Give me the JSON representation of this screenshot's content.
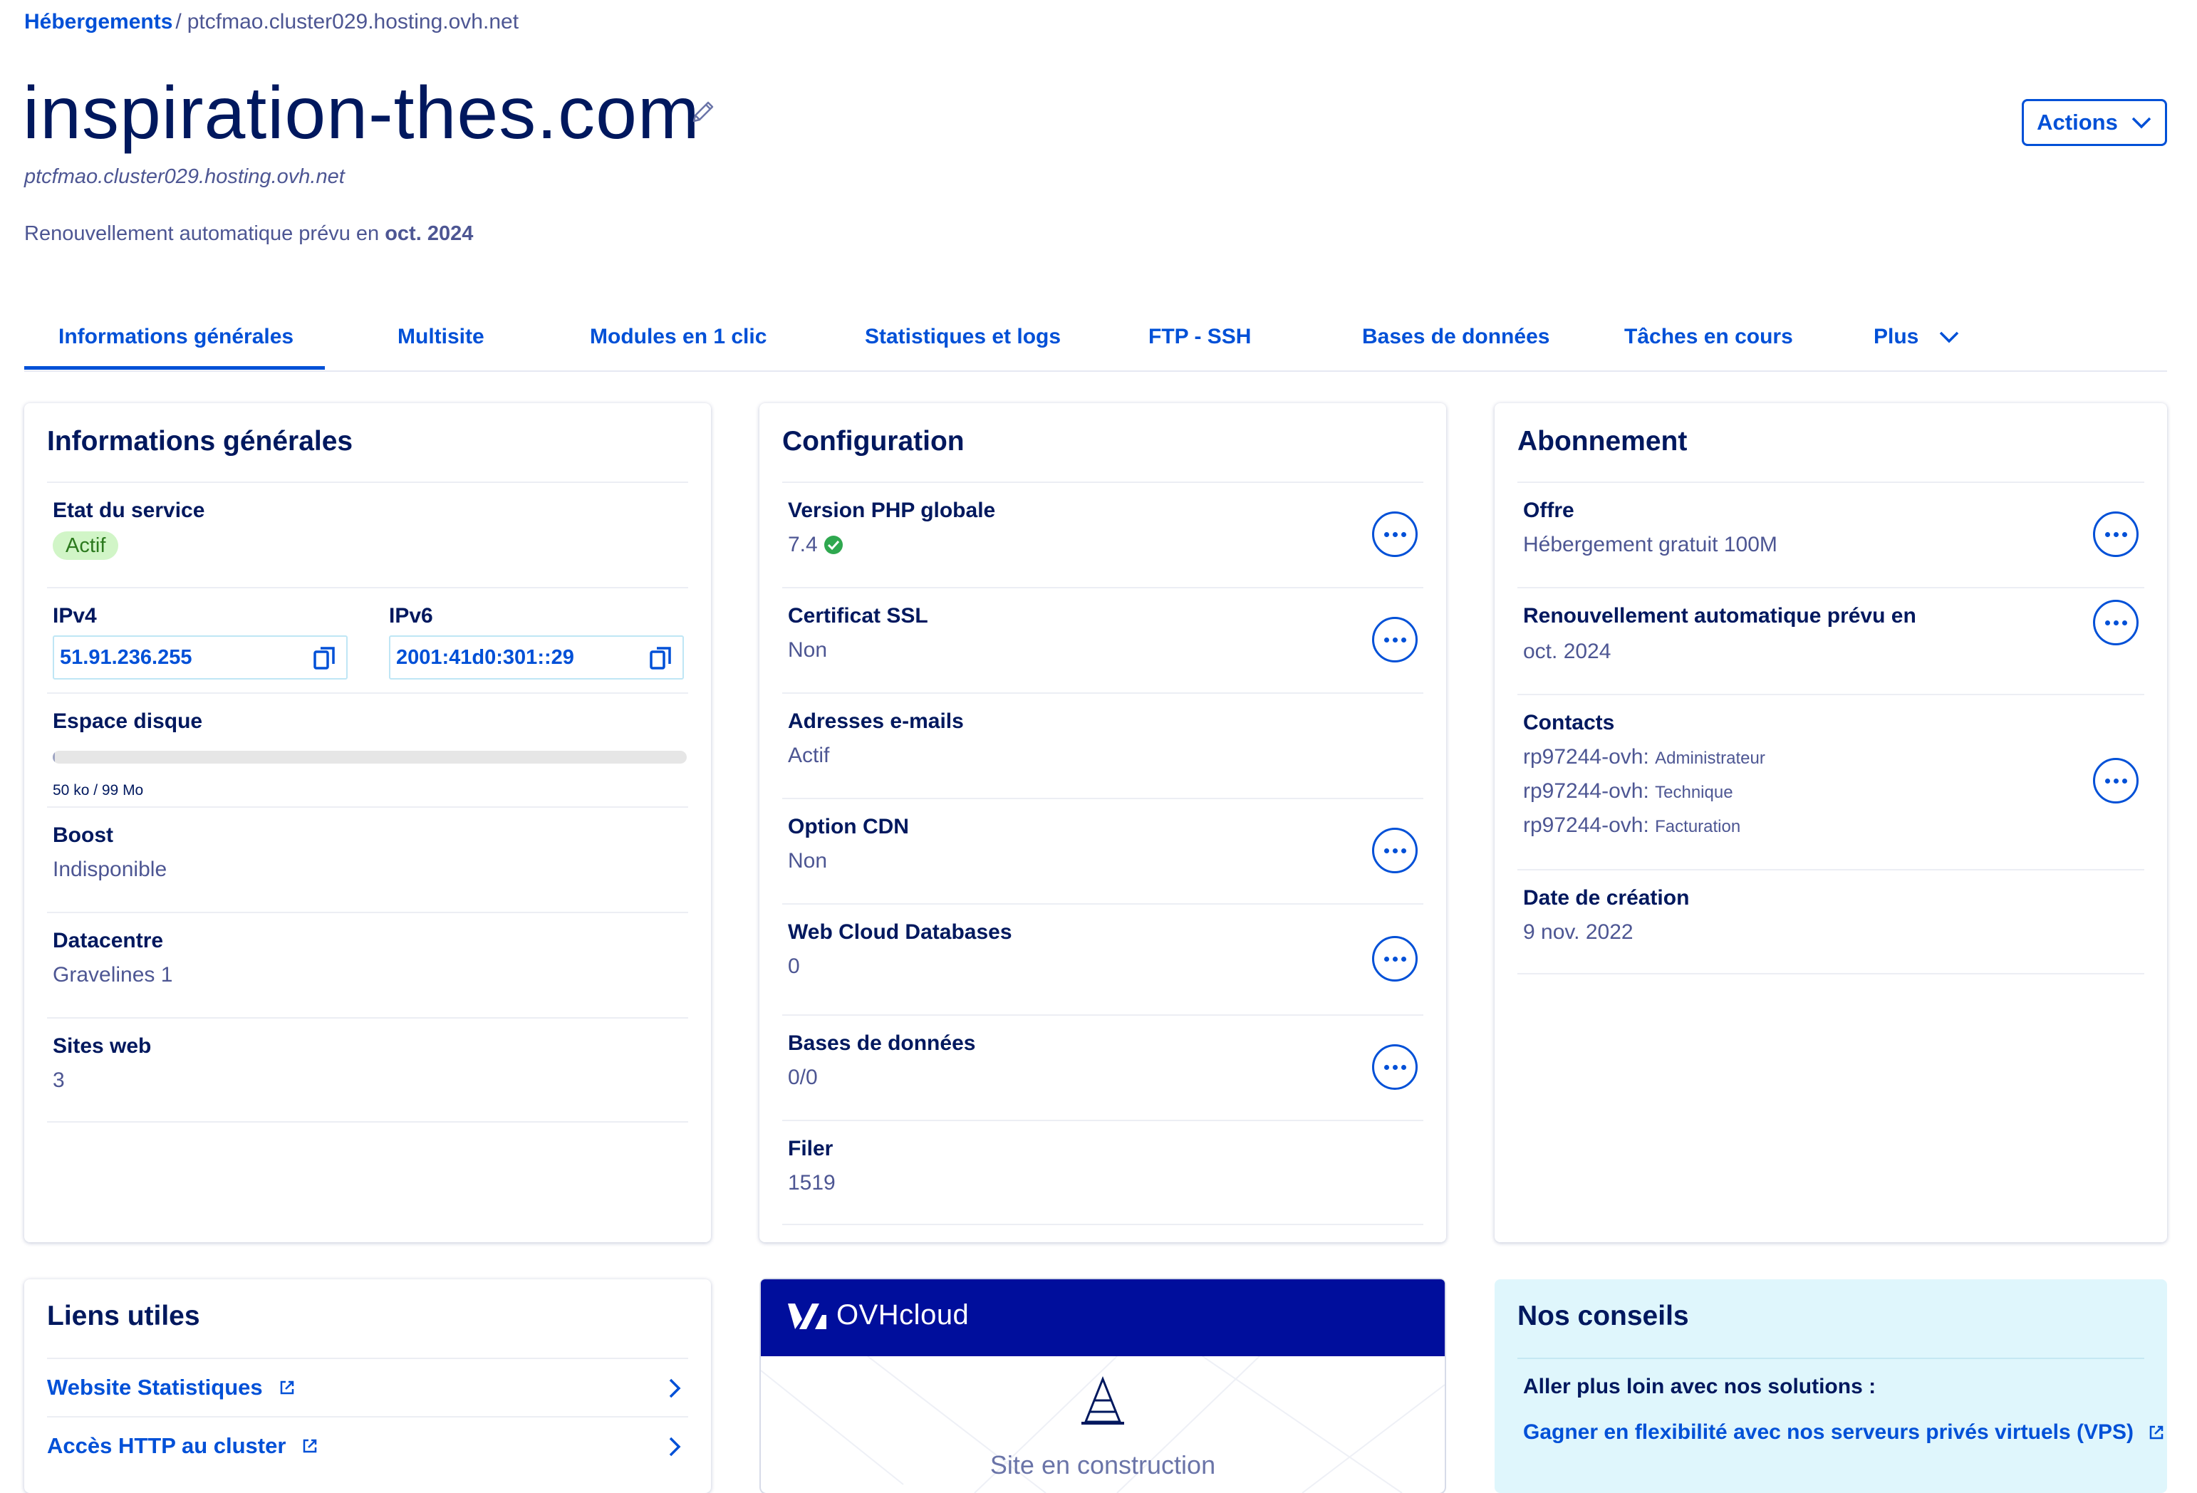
{
  "breadcrumb": {
    "root": "Hébergements",
    "separator": "/",
    "current": "ptcfmao.cluster029.hosting.ovh.net"
  },
  "header": {
    "title": "inspiration-thes.com",
    "subtitle": "ptcfmao.cluster029.hosting.ovh.net",
    "renewal_prefix": "Renouvellement automatique prévu en",
    "renewal_date": "oct. 2024",
    "actions_label": "Actions"
  },
  "tabs": [
    {
      "label": "Informations générales",
      "active": true
    },
    {
      "label": "Multisite"
    },
    {
      "label": "Modules en 1 clic"
    },
    {
      "label": "Statistiques et logs"
    },
    {
      "label": "FTP - SSH"
    },
    {
      "label": "Bases de données"
    },
    {
      "label": "Tâches en cours"
    },
    {
      "label": "Plus"
    }
  ],
  "general": {
    "title": "Informations générales",
    "service_state_label": "Etat du service",
    "service_state_value": "Actif",
    "ipv4_label": "IPv4",
    "ipv4_value": "51.91.236.255",
    "ipv6_label": "IPv6",
    "ipv6_value": "2001:41d0:301::29",
    "disk_label": "Espace disque",
    "disk_value": "50 ko / 99 Mo",
    "disk_used_fraction": 0.0005,
    "boost_label": "Boost",
    "boost_value": "Indisponible",
    "datacenter_label": "Datacentre",
    "datacenter_value": "Gravelines 1",
    "sites_label": "Sites web",
    "sites_value": "3"
  },
  "config": {
    "title": "Configuration",
    "php_label": "Version PHP globale",
    "php_value": "7.4",
    "ssl_label": "Certificat SSL",
    "ssl_value": "Non",
    "email_label": "Adresses e-mails",
    "email_value": "Actif",
    "cdn_label": "Option CDN",
    "cdn_value": "Non",
    "wcdb_label": "Web Cloud Databases",
    "wcdb_value": "0",
    "db_label": "Bases de données",
    "db_value": "0/0",
    "filer_label": "Filer",
    "filer_value": "1519"
  },
  "subscription": {
    "title": "Abonnement",
    "offer_label": "Offre",
    "offer_value": "Hébergement gratuit 100M",
    "renewal_label": "Renouvellement automatique prévu en",
    "renewal_value": "oct. 2024",
    "contacts_label": "Contacts",
    "contacts": [
      {
        "id": "rp97244-ovh:",
        "role": "Administrateur"
      },
      {
        "id": "rp97244-ovh:",
        "role": "Technique"
      },
      {
        "id": "rp97244-ovh:",
        "role": "Facturation"
      }
    ],
    "creation_label": "Date de création",
    "creation_value": "9 nov. 2022"
  },
  "links": {
    "title": "Liens utiles",
    "items": [
      "Website Statistiques",
      "Accès HTTP au cluster"
    ]
  },
  "preview": {
    "brand": "OVHcloud",
    "caption": "Site en construction"
  },
  "tips": {
    "title": "Nos conseils",
    "heading": "Aller plus loin avec nos solutions :",
    "link": "Gagner en flexibilité avec nos serveurs privés virtuels (VPS)"
  },
  "colors": {
    "primary": "#0050d7",
    "navy": "#000e9c",
    "title": "#00185e",
    "text": "#4d5693",
    "success": "#2c7a1e",
    "tips_bg": "#dff6fc"
  }
}
